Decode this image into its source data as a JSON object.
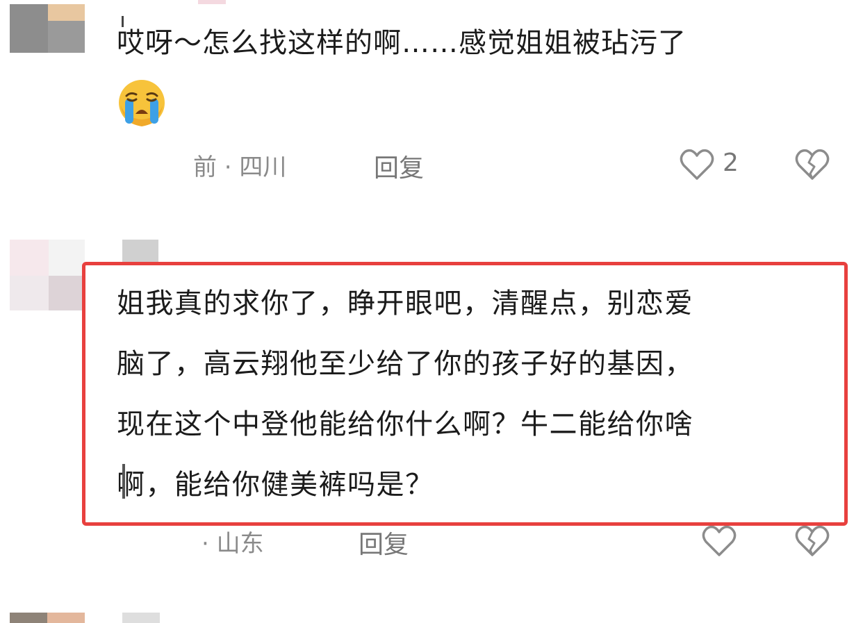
{
  "comments": [
    {
      "lines": [
        "哎呀～怎么找这样的啊……感觉姐姐被玷污了"
      ],
      "emoji": "loudly-crying-face",
      "meta": "前 · 四川",
      "reply_label": "回复",
      "like_count": "2"
    },
    {
      "lines": [
        "姐我真的求你了，睁开眼吧，清醒点，别恋爱",
        "脑了，高云翔他至少给了你的孩子好的基因，",
        "现在这个中登他能给你什么啊？牛二能给你啥",
        "啊，能给你健美裤吗是？"
      ],
      "meta": "· 山东",
      "reply_label": "回复"
    }
  ],
  "colors": {
    "highlight_border": "#e8403e",
    "meta_text": "#8a8a8a",
    "icon_stroke": "#8c8c8c"
  },
  "icons": {
    "like": "heart-outline-icon",
    "dislike": "broken-heart-icon"
  }
}
